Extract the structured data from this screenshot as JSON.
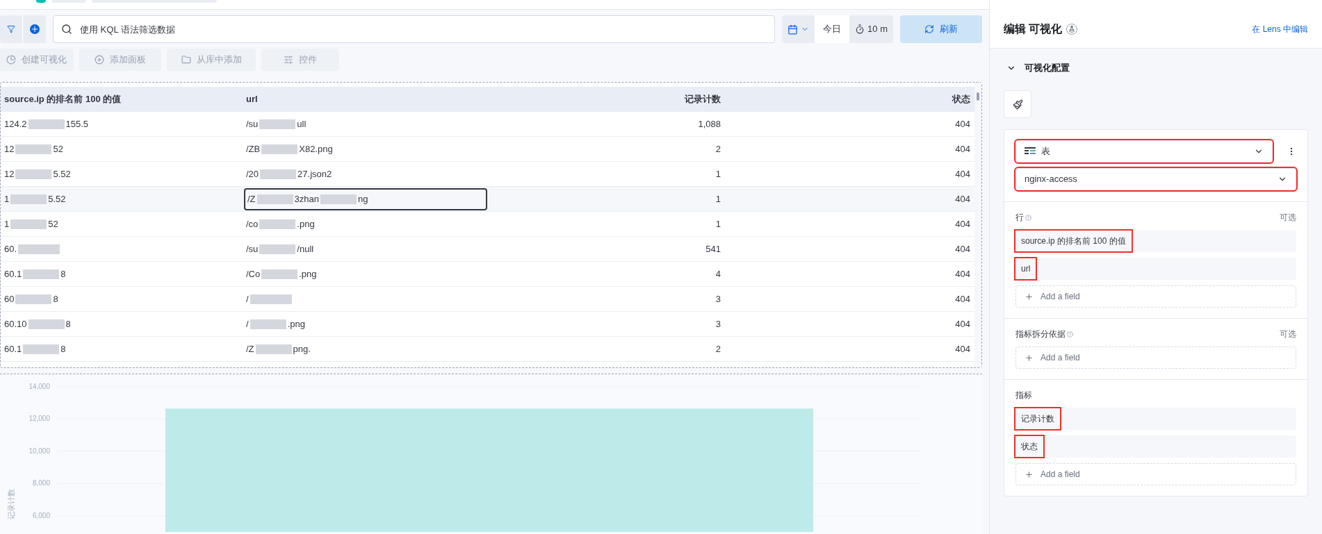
{
  "toolbar": {
    "search_placeholder": "使用 KQL 语法筛选数据",
    "date_label": "今日",
    "refresh_interval": "10 m",
    "refresh_button": "刷新"
  },
  "actions": [
    "创建可视化",
    "添加面板",
    "从库中添加",
    "控件"
  ],
  "table": {
    "columns": [
      "source.ip 的排名前 100 的值",
      "url",
      "记录计数",
      "状态"
    ],
    "rows": [
      {
        "ip": [
          "124.2",
          "155.5"
        ],
        "url": [
          "/su",
          "ull"
        ],
        "count": "1,088",
        "status": "404",
        "selected": false
      },
      {
        "ip": [
          "12",
          "52"
        ],
        "url": [
          "/ZB",
          "X82.png"
        ],
        "count": "2",
        "status": "404",
        "selected": false
      },
      {
        "ip": [
          "12",
          "5.52"
        ],
        "url": [
          "/20",
          "27.json2"
        ],
        "count": "1",
        "status": "404",
        "selected": false
      },
      {
        "ip": [
          "1",
          "5.52"
        ],
        "url": [
          "/Z",
          "3zhan",
          "ng"
        ],
        "count": "1",
        "status": "404",
        "selected": true
      },
      {
        "ip": [
          "1",
          "52"
        ],
        "url": [
          "/co",
          ".png"
        ],
        "count": "1",
        "status": "404",
        "selected": false
      },
      {
        "ip": [
          "60."
        ],
        "url": [
          "/su",
          "/null"
        ],
        "count": "541",
        "status": "404",
        "selected": false
      },
      {
        "ip": [
          "60.1",
          "8"
        ],
        "url": [
          "/Co",
          ".png"
        ],
        "count": "4",
        "status": "404",
        "selected": false
      },
      {
        "ip": [
          "60",
          "8"
        ],
        "url": [
          "/"
        ],
        "count": "3",
        "status": "404",
        "selected": false
      },
      {
        "ip": [
          "60.10",
          "8"
        ],
        "url": [
          "/",
          ".png"
        ],
        "count": "3",
        "status": "404",
        "selected": false
      },
      {
        "ip": [
          "60.1",
          "8"
        ],
        "url": [
          "/Z",
          "png."
        ],
        "count": "2",
        "status": "404",
        "selected": false
      }
    ]
  },
  "chart": {
    "chart_data": {
      "type": "bar",
      "ylabel": "记录计数",
      "values": [
        12650
      ],
      "ylim": [
        5000,
        14000
      ],
      "grid": true,
      "yticks": [
        {
          "value": 6000,
          "label": "6,000"
        },
        {
          "value": 8000,
          "label": "8,000"
        },
        {
          "value": 10000,
          "label": "10,000"
        },
        {
          "value": 12000,
          "label": "12,000"
        },
        {
          "value": 14000,
          "label": "14,000"
        }
      ]
    }
  },
  "panel": {
    "title": "编辑 可视化",
    "link": "在 Lens 中编辑",
    "section": "可视化配置",
    "expanded": true,
    "chart_type": {
      "label": "表",
      "highlighted": true
    },
    "data_view": {
      "label": "nginx-access",
      "highlighted": true
    },
    "groups": [
      {
        "title": "行",
        "help": true,
        "optional": "可选",
        "fields": [
          {
            "label": "source.ip 的排名前 100 的值",
            "highlighted": true
          },
          {
            "label": "url",
            "highlighted": true
          }
        ],
        "add": "Add a field"
      },
      {
        "title": "指标拆分依据",
        "help": true,
        "optional": "可选",
        "add": "Add a field"
      },
      {
        "title": "指标",
        "help": false,
        "fields": [
          {
            "label": "记录计数",
            "highlighted": true
          },
          {
            "label": "状态",
            "highlighted": true
          }
        ],
        "add": "Add a field"
      }
    ]
  }
}
